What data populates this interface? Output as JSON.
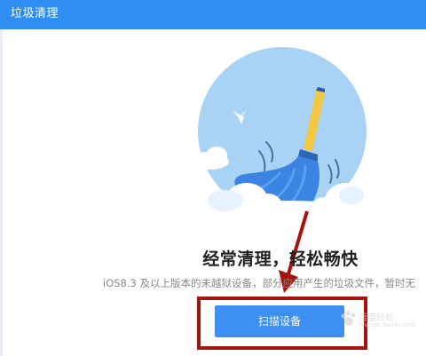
{
  "window": {
    "title": "垃圾清理"
  },
  "main": {
    "headline": "经常清理，轻松畅快",
    "subtext": "iOS8.3 及以上版本的未越狱设备，部分应用产生的垃圾文件，暂时无",
    "scan_button_label": "扫描设备"
  },
  "watermark": {
    "text": "百度经验",
    "subtext": "jingyan.baidu.com"
  },
  "icons": {
    "illustration": "broom-cleaning-icon",
    "bird": "bird-icon",
    "annotation_arrow": "arrow-down-icon"
  },
  "colors": {
    "titlebar": "#2e8ef2",
    "button": "#3d8ff1",
    "circle": "#a9d3f5",
    "annotation": "#a4140c"
  }
}
